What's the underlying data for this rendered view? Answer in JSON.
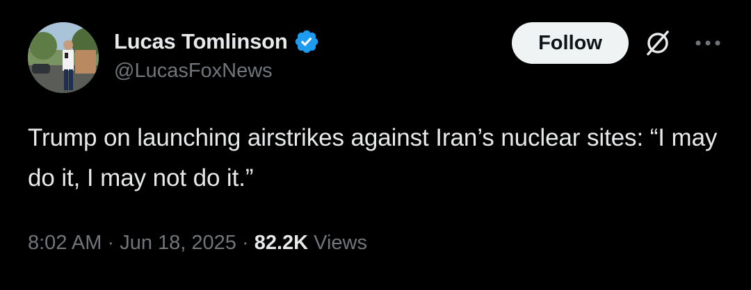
{
  "author": {
    "display_name": "Lucas Tomlinson",
    "handle": "@LucasFoxNews",
    "verified": true
  },
  "actions": {
    "follow_label": "Follow",
    "grok_icon": "grok-icon",
    "more_icon": "more-options-icon"
  },
  "tweet": {
    "text": "Trump on launching airstrikes against Iran’s nuclear sites: “I may do it, I may not do it.”",
    "time": "8:02 AM",
    "separator": "·",
    "date": "Jun 18, 2025",
    "views_count": "82.2K",
    "views_label": "Views"
  },
  "colors": {
    "background": "#000000",
    "primary_text": "#e7e9ea",
    "secondary_text": "#71767b",
    "verified_blue": "#1d9bf0",
    "follow_bg": "#eff3f4"
  }
}
